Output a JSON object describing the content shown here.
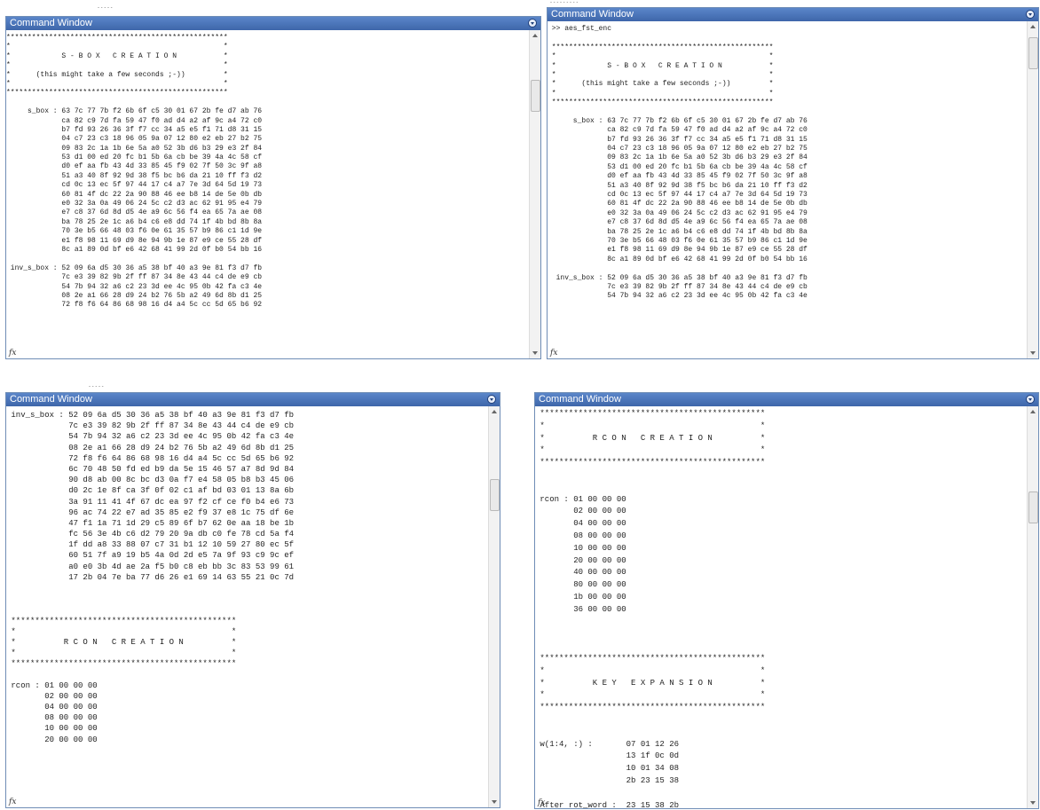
{
  "fragments": {
    "top_left": "- - - - -",
    "top_right": "- - - - - - - - -",
    "mid_left": "- - - - -"
  },
  "windows": [
    {
      "title": "Command Window",
      "lines": [
        "****************************************************",
        "*                                                  *",
        "*            S - B O X   C R E A T I O N           *",
        "*                                                  *",
        "*      (this might take a few seconds ;-))         *",
        "*                                                  *",
        "****************************************************",
        "",
        "     s_box : 63 7c 77 7b f2 6b 6f c5 30 01 67 2b fe d7 ab 76",
        "             ca 82 c9 7d fa 59 47 f0 ad d4 a2 af 9c a4 72 c0",
        "             b7 fd 93 26 36 3f f7 cc 34 a5 e5 f1 71 d8 31 15",
        "             04 c7 23 c3 18 96 05 9a 07 12 80 e2 eb 27 b2 75",
        "             09 83 2c 1a 1b 6e 5a a0 52 3b d6 b3 29 e3 2f 84",
        "             53 d1 00 ed 20 fc b1 5b 6a cb be 39 4a 4c 58 cf",
        "             d0 ef aa fb 43 4d 33 85 45 f9 02 7f 50 3c 9f a8",
        "             51 a3 40 8f 92 9d 38 f5 bc b6 da 21 10 ff f3 d2",
        "             cd 0c 13 ec 5f 97 44 17 c4 a7 7e 3d 64 5d 19 73",
        "             60 81 4f dc 22 2a 90 88 46 ee b8 14 de 5e 0b db",
        "             e0 32 3a 0a 49 06 24 5c c2 d3 ac 62 91 95 e4 79",
        "             e7 c8 37 6d 8d d5 4e a9 6c 56 f4 ea 65 7a ae 08",
        "             ba 78 25 2e 1c a6 b4 c6 e8 dd 74 1f 4b bd 8b 8a",
        "             70 3e b5 66 48 03 f6 0e 61 35 57 b9 86 c1 1d 9e",
        "             e1 f8 98 11 69 d9 8e 94 9b 1e 87 e9 ce 55 28 df",
        "             8c a1 89 0d bf e6 42 68 41 99 2d 0f b0 54 bb 16",
        "",
        " inv_s_box : 52 09 6a d5 30 36 a5 38 bf 40 a3 9e 81 f3 d7 fb",
        "             7c e3 39 82 9b 2f ff 87 34 8e 43 44 c4 de e9 cb",
        "             54 7b 94 32 a6 c2 23 3d ee 4c 95 0b 42 fa c3 4e",
        "             08 2e a1 66 28 d9 24 b2 76 5b a2 49 6d 8b d1 25",
        "             72 f8 f6 64 86 68 98 16 d4 a4 5c cc 5d 65 b6 92"
      ]
    },
    {
      "title": "Command Window",
      "lines": [
        " >> aes_fst_enc",
        "",
        " ****************************************************",
        " *                                                  *",
        " *            S - B O X   C R E A T I O N           *",
        " *                                                  *",
        " *      (this might take a few seconds ;-))         *",
        " *                                                  *",
        " ****************************************************",
        "",
        "      s_box : 63 7c 77 7b f2 6b 6f c5 30 01 67 2b fe d7 ab 76",
        "              ca 82 c9 7d fa 59 47 f0 ad d4 a2 af 9c a4 72 c0",
        "              b7 fd 93 26 36 3f f7 cc 34 a5 e5 f1 71 d8 31 15",
        "              04 c7 23 c3 18 96 05 9a 07 12 80 e2 eb 27 b2 75",
        "              09 83 2c 1a 1b 6e 5a a0 52 3b d6 b3 29 e3 2f 84",
        "              53 d1 00 ed 20 fc b1 5b 6a cb be 39 4a 4c 58 cf",
        "              d0 ef aa fb 43 4d 33 85 45 f9 02 7f 50 3c 9f a8",
        "              51 a3 40 8f 92 9d 38 f5 bc b6 da 21 10 ff f3 d2",
        "              cd 0c 13 ec 5f 97 44 17 c4 a7 7e 3d 64 5d 19 73",
        "              60 81 4f dc 22 2a 90 88 46 ee b8 14 de 5e 0b db",
        "              e0 32 3a 0a 49 06 24 5c c2 d3 ac 62 91 95 e4 79",
        "              e7 c8 37 6d 8d d5 4e a9 6c 56 f4 ea 65 7a ae 08",
        "              ba 78 25 2e 1c a6 b4 c6 e8 dd 74 1f 4b bd 8b 8a",
        "              70 3e b5 66 48 03 f6 0e 61 35 57 b9 86 c1 1d 9e",
        "              e1 f8 98 11 69 d9 8e 94 9b 1e 87 e9 ce 55 28 df",
        "              8c a1 89 0d bf e6 42 68 41 99 2d 0f b0 54 bb 16",
        "",
        "  inv_s_box : 52 09 6a d5 30 36 a5 38 bf 40 a3 9e 81 f3 d7 fb",
        "              7c e3 39 82 9b 2f ff 87 34 8e 43 44 c4 de e9 cb",
        "              54 7b 94 32 a6 c2 23 3d ee 4c 95 0b 42 fa c3 4e"
      ]
    },
    {
      "title": "Command Window",
      "lines": [
        " inv_s_box : 52 09 6a d5 30 36 a5 38 bf 40 a3 9e 81 f3 d7 fb",
        "             7c e3 39 82 9b 2f ff 87 34 8e 43 44 c4 de e9 cb",
        "             54 7b 94 32 a6 c2 23 3d ee 4c 95 0b 42 fa c3 4e",
        "             08 2e a1 66 28 d9 24 b2 76 5b a2 49 6d 8b d1 25",
        "             72 f8 f6 64 86 68 98 16 d4 a4 5c cc 5d 65 b6 92",
        "             6c 70 48 50 fd ed b9 da 5e 15 46 57 a7 8d 9d 84",
        "             90 d8 ab 00 8c bc d3 0a f7 e4 58 05 b8 b3 45 06",
        "             d0 2c 1e 8f ca 3f 0f 02 c1 af bd 03 01 13 8a 6b",
        "             3a 91 11 41 4f 67 dc ea 97 f2 cf ce f0 b4 e6 73",
        "             96 ac 74 22 e7 ad 35 85 e2 f9 37 e8 1c 75 df 6e",
        "             47 f1 1a 71 1d 29 c5 89 6f b7 62 0e aa 18 be 1b",
        "             fc 56 3e 4b c6 d2 79 20 9a db c0 fe 78 cd 5a f4",
        "             1f dd a8 33 88 07 c7 31 b1 12 10 59 27 80 ec 5f",
        "             60 51 7f a9 19 b5 4a 0d 2d e5 7a 9f 93 c9 9c ef",
        "             a0 e0 3b 4d ae 2a f5 b0 c8 eb bb 3c 83 53 99 61",
        "             17 2b 04 7e ba 77 d6 26 e1 69 14 63 55 21 0c 7d",
        "",
        "",
        "",
        " ***********************************************",
        " *                                             *",
        " *          R C O N   C R E A T I O N          *",
        " *                                             *",
        " ***********************************************",
        "",
        " rcon : 01 00 00 00",
        "        02 00 00 00",
        "        04 00 00 00",
        "        08 00 00 00",
        "        10 00 00 00",
        "        20 00 00 00"
      ]
    },
    {
      "title": "Command Window",
      "lines": [
        " ***********************************************",
        " *                                             *",
        " *          R C O N   C R E A T I O N          *",
        " *                                             *",
        " ***********************************************",
        "",
        "",
        " rcon : 01 00 00 00",
        "        02 00 00 00",
        "        04 00 00 00",
        "        08 00 00 00",
        "        10 00 00 00",
        "        20 00 00 00",
        "        40 00 00 00",
        "        80 00 00 00",
        "        1b 00 00 00",
        "        36 00 00 00",
        "",
        "",
        "",
        " ***********************************************",
        " *                                             *",
        " *          K E Y   E X P A N S I O N          *",
        " *                                             *",
        " ***********************************************",
        "",
        "",
        " w(1:4, :) :       07 01 12 26",
        "                   13 1f 0c 0d",
        "                   10 01 34 08",
        "                   2b 23 15 38",
        "",
        " After rot_word :  23 15 38 2b"
      ]
    }
  ]
}
